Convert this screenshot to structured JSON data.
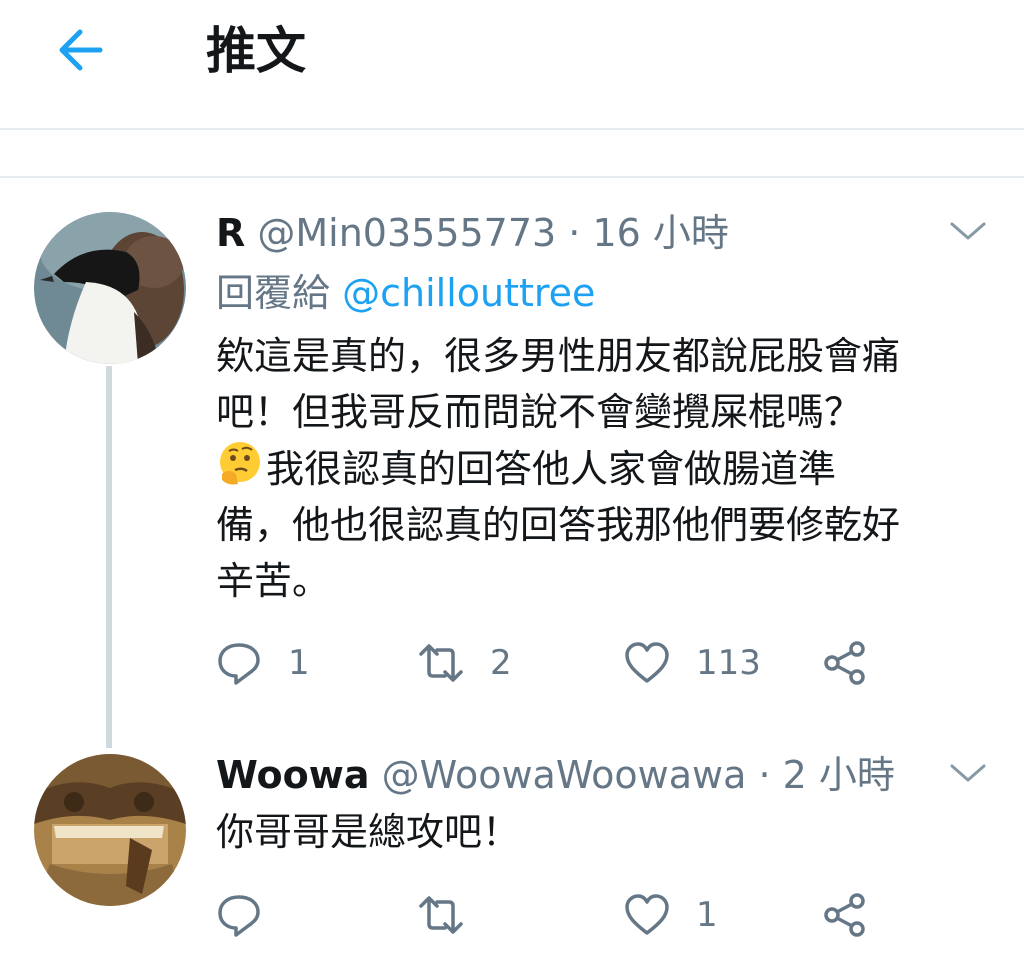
{
  "header": {
    "title": "推文",
    "back_icon": "arrow-left-icon",
    "accent": "#1da1f2"
  },
  "tweets": [
    {
      "name": "R",
      "handle": "@Min03555773",
      "time": "· 16 小時",
      "reply_to_label": "回覆給",
      "reply_to_user": "@chillouttree",
      "text_line1": "欸這是真的，很多男性朋友都說屁股會痛",
      "text_line2": "吧！但我哥反而問說不會變攪屎棍嗎？",
      "text_line3": "我很認真的回答他人家會做腸道準",
      "text_line4": "備，他也很認真的回答我那他們要修乾好",
      "text_line5": "辛苦。",
      "emoji": "thinking-face-emoji",
      "replies": "1",
      "retweets": "2",
      "likes": "113"
    },
    {
      "name": "Woowa",
      "handle": "@WoowaWoowawa",
      "time": "· 2 小時",
      "text_line1": "你哥哥是總攻吧！",
      "replies": "",
      "retweets": "",
      "likes": "1"
    }
  ]
}
